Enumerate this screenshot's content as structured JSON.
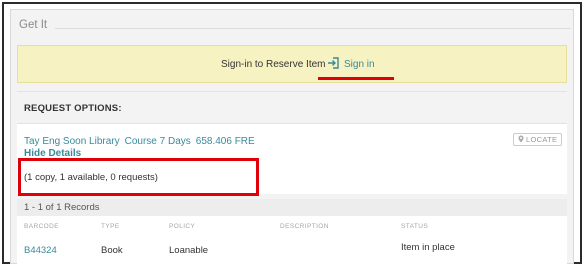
{
  "section": {
    "title": "Get It"
  },
  "signin": {
    "prompt": "Sign-in to Reserve Item",
    "link_label": "Sign in",
    "icon": "sign-in-icon"
  },
  "request_options": {
    "title": "REQUEST OPTIONS:"
  },
  "holding": {
    "library": "Tay Eng Soon Library",
    "location": "Course 7 Days",
    "call_number": "658.406 FRE",
    "hide_details_label": "Hide Details",
    "summary": "(1 copy, 1 available, 0 requests)",
    "locate_label": "LOCATE",
    "locate_icon": "map-pin-icon"
  },
  "records": {
    "label": "1 - 1 of 1 Records"
  },
  "items_table": {
    "columns": [
      "BARCODE",
      "TYPE",
      "POLICY",
      "DESCRIPTION",
      "STATUS"
    ],
    "rows": [
      {
        "barcode": "B44324",
        "type": "Book",
        "policy": "Loanable",
        "description": "",
        "status": "Item in place"
      }
    ]
  },
  "colors": {
    "link": "#3a8a9a",
    "signin_bar": "#f6f2c2",
    "highlight_red": "#e0000a"
  }
}
